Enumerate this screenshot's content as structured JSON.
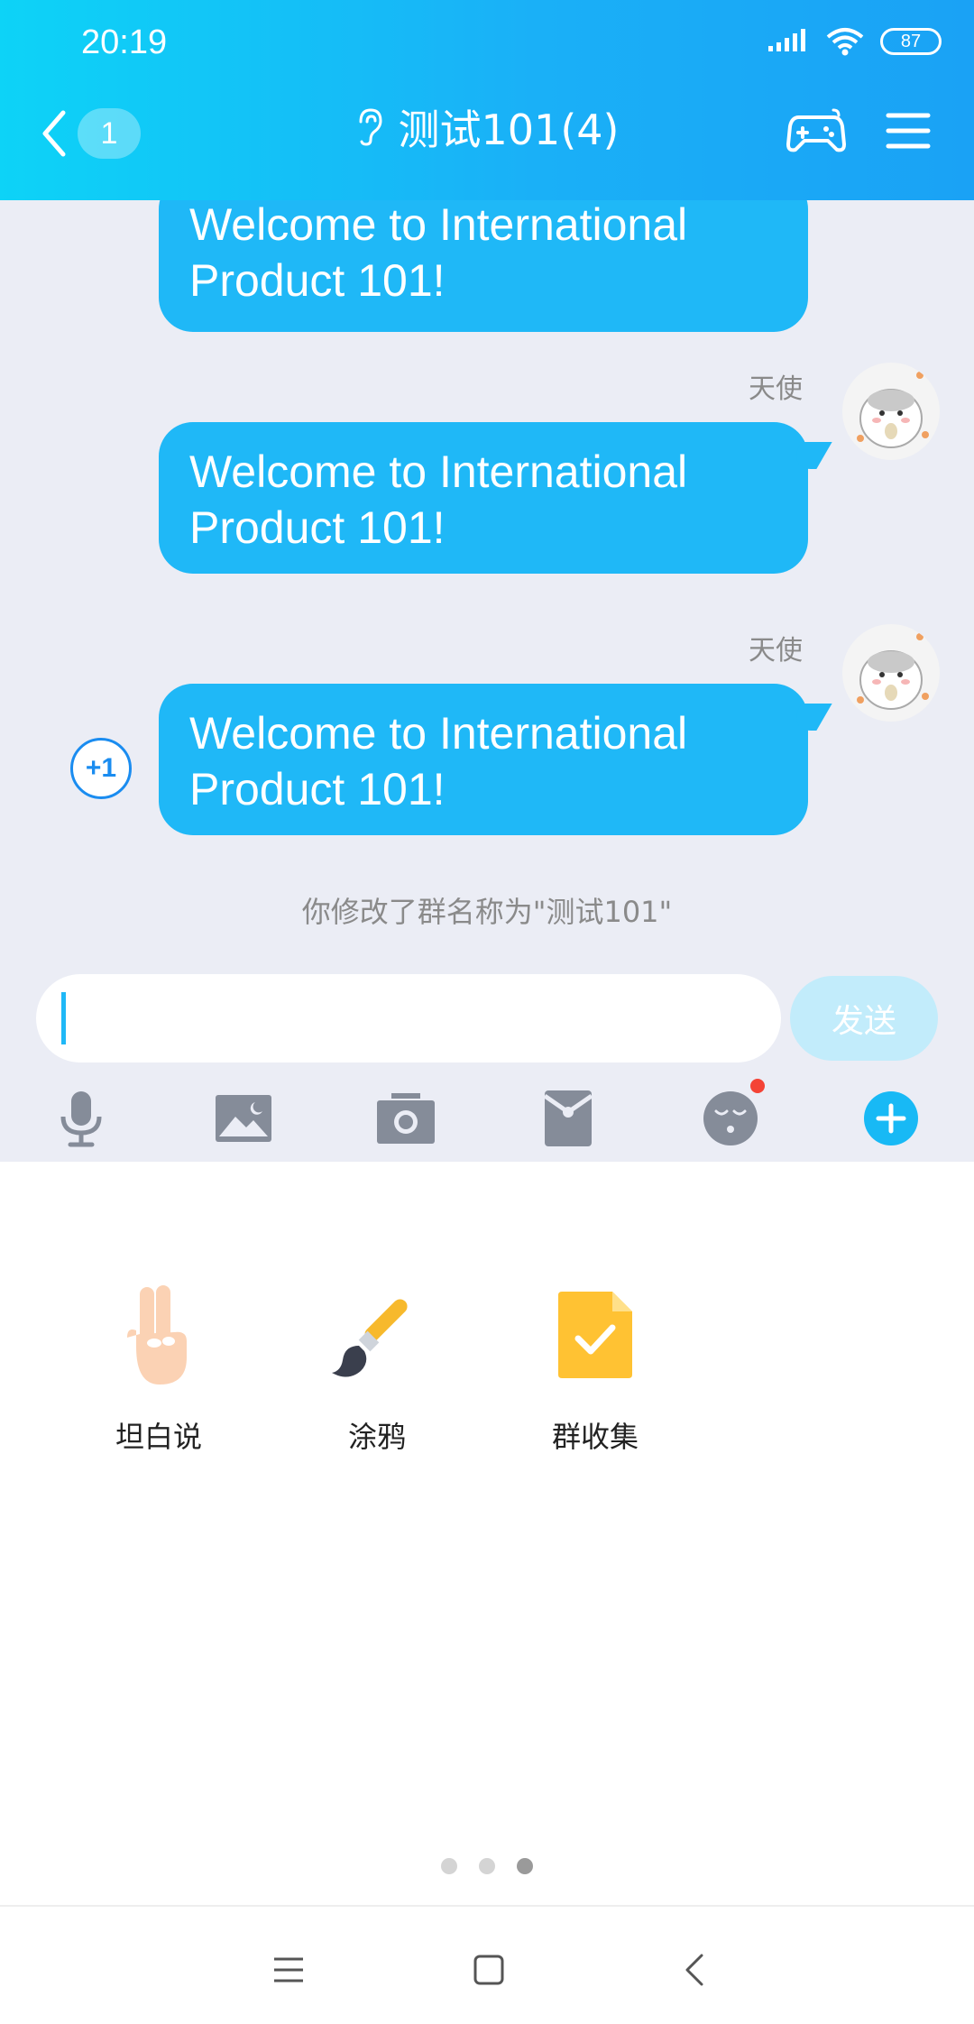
{
  "status_bar": {
    "time": "20:19",
    "battery": "87"
  },
  "header": {
    "back_badge": "1",
    "title": "测试101(4)"
  },
  "messages": [
    {
      "text": "Welcome to International Product 101!"
    },
    {
      "sender": "天使",
      "text": "Welcome to International Product 101!"
    },
    {
      "sender": "天使",
      "text": "Welcome to International Product 101!",
      "plus_one": "+1"
    }
  ],
  "system_message": "你修改了群名称为\"测试101\"",
  "input": {
    "value": "",
    "send_label": "发送"
  },
  "toolbar": {
    "items": [
      "microphone-icon",
      "image-icon",
      "camera-icon",
      "red-packet-icon",
      "emoji-icon",
      "plus-icon"
    ],
    "emoji_has_notification": true
  },
  "apps": [
    {
      "label": "坦白说",
      "icon": "hand-icon"
    },
    {
      "label": "涂鸦",
      "icon": "paintbrush-icon"
    },
    {
      "label": "群收集",
      "icon": "checked-document-icon"
    }
  ],
  "pager": {
    "count": 3,
    "active_index": 3
  },
  "colors": {
    "header_start": "#0dd3f7",
    "header_end": "#1aa2f5",
    "bubble": "#1fb8f7",
    "send_disabled": "#c2ecfb"
  }
}
